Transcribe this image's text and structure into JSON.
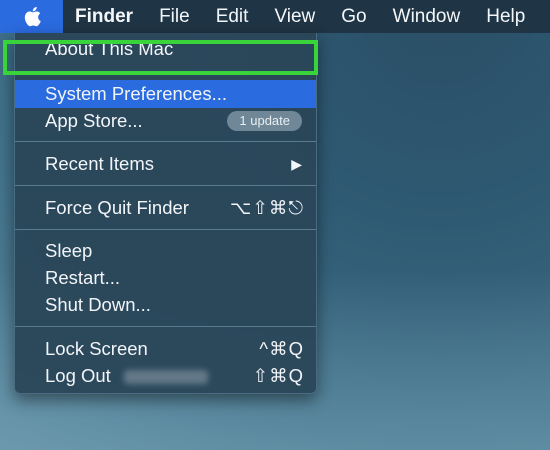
{
  "menubar": {
    "apple_icon": "apple-icon",
    "items": [
      "Finder",
      "File",
      "Edit",
      "View",
      "Go",
      "Window",
      "Help"
    ]
  },
  "apple_menu": {
    "about": "About This Mac",
    "system_preferences": "System Preferences...",
    "app_store": "App Store...",
    "app_store_badge": "1 update",
    "recent_items": "Recent Items",
    "recent_items_arrow": "▶",
    "force_quit": "Force Quit Finder",
    "force_quit_shortcut": "⌥⇧⌘⎋",
    "sleep": "Sleep",
    "restart": "Restart...",
    "shut_down": "Shut Down...",
    "lock_screen": "Lock Screen",
    "lock_screen_shortcut": "^⌘Q",
    "log_out": "Log Out",
    "log_out_shortcut": "⇧⌘Q"
  },
  "colors": {
    "highlight": "#2b6be0",
    "annotation_box": "#39d439",
    "menubar": "#1f3444"
  }
}
